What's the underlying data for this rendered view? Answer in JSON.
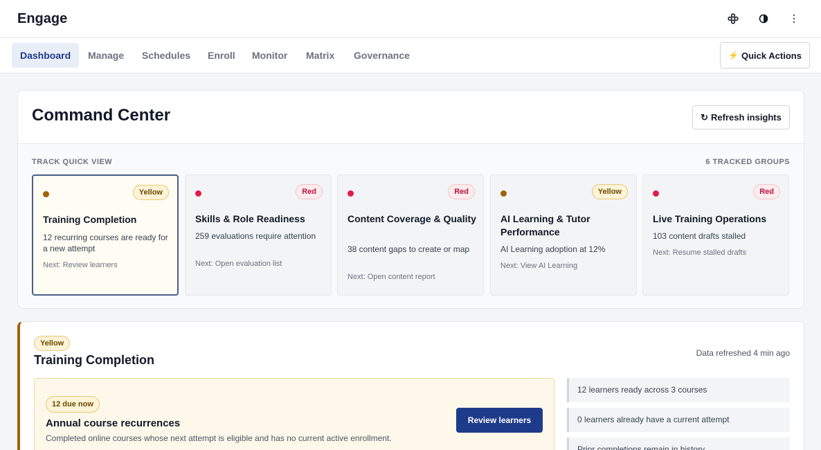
{
  "app": {
    "title": "Engage"
  },
  "top_icons": [
    "workflow-icon",
    "contrast-icon",
    "more-vertical-icon"
  ],
  "nav": {
    "tabs": [
      {
        "label": "Dashboard",
        "active": true
      },
      {
        "label": "Manage"
      },
      {
        "label": "Schedules"
      },
      {
        "label": "Enroll"
      },
      {
        "label": "Monitor"
      },
      {
        "label": "Matrix"
      },
      {
        "label": "Governance"
      }
    ],
    "quick_actions": {
      "icon": "⚡",
      "label": "Quick Actions"
    }
  },
  "command_center": {
    "title": "Command Center",
    "refresh": {
      "icon": "↻",
      "label": "Refresh insights"
    },
    "quick_view_label": "TRACK QUICK VIEW",
    "tracked_groups": "6 TRACKED GROUPS",
    "cards": [
      {
        "status": "Yellow",
        "color": "#a16207",
        "title": "Training Completion",
        "description": "12 recurring courses are ready for a new attempt",
        "next": "Next: Review learners",
        "selected": true
      },
      {
        "status": "Red",
        "color": "#e11d48",
        "title": "Skills & Role Readiness",
        "description": "259 evaluations require attention",
        "next": "Next: Open evaluation list"
      },
      {
        "status": "Red",
        "color": "#e11d48",
        "title": "Content Coverage & Quality",
        "description": "38 content gaps to create or map",
        "next": "Next: Open content report"
      },
      {
        "status": "Yellow",
        "color": "#a16207",
        "title": "AI Learning & Tutor Performance",
        "description": "AI Learning adoption at 12%",
        "next": "Next: View AI Learning"
      },
      {
        "status": "Red",
        "color": "#e11d48",
        "title": "Live Training Operations",
        "description": "103 content drafts stalled",
        "next": "Next: Resume stalled drafts"
      }
    ]
  },
  "detail": {
    "status": "Yellow",
    "title": "Training Completion",
    "refreshed": "Data refreshed 4 min ago",
    "recommendation": {
      "badge": "12 due now",
      "title": "Annual course recurrences",
      "description": "Completed online courses whose next attempt is eligible and has no current active enrollment.",
      "button": "Review learners"
    },
    "facts": [
      "12 learners ready across 3 courses",
      "0 learners already have a current attempt",
      "Prior completions remain in history"
    ]
  }
}
